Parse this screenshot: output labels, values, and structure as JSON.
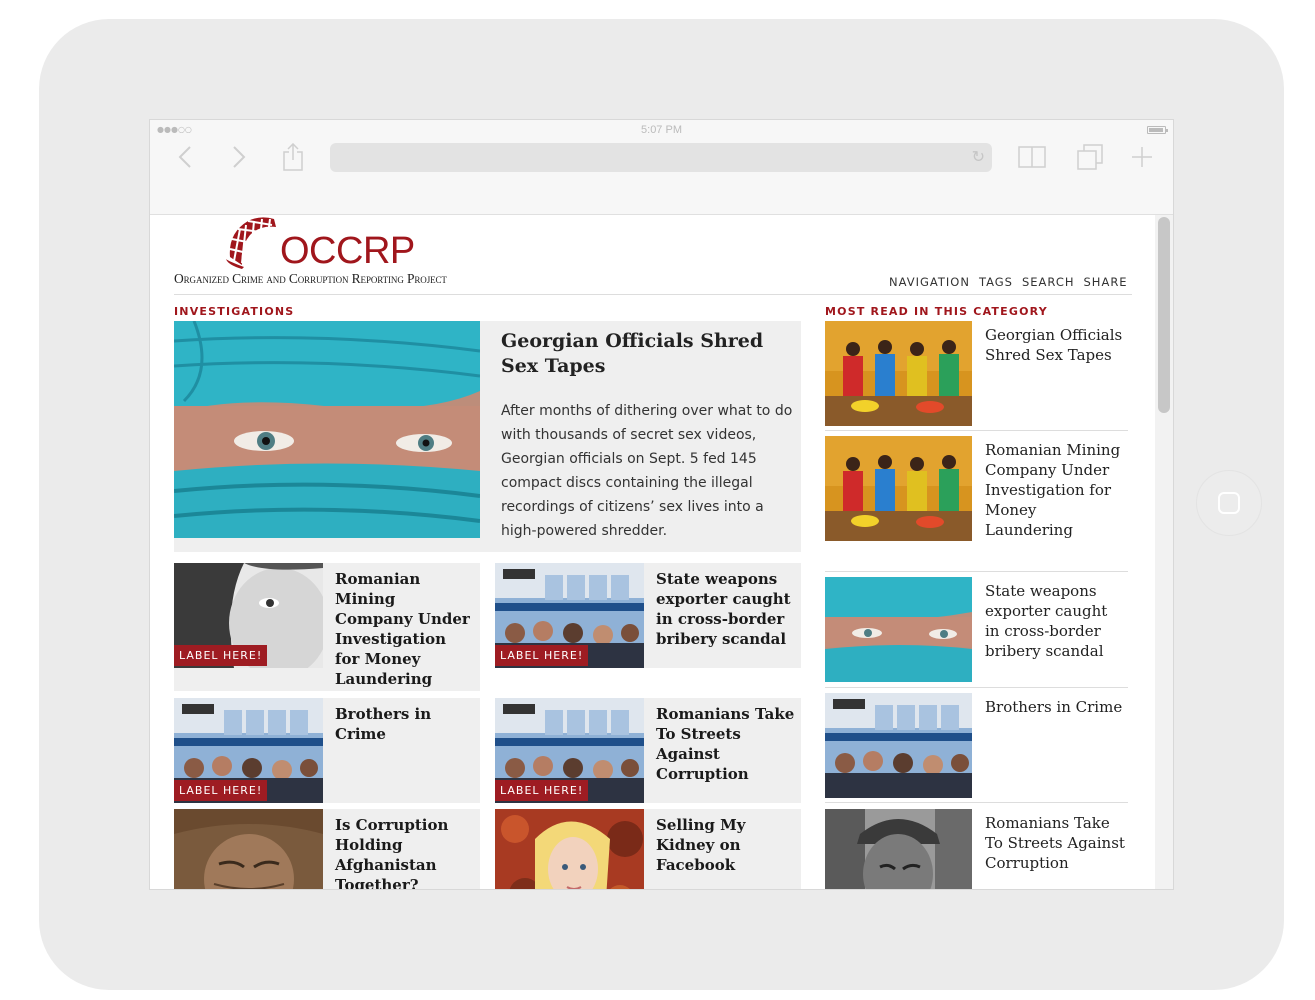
{
  "device": {
    "type": "tablet"
  },
  "statusbar": {
    "time": "5:07 PM",
    "signal": "●●●○○"
  },
  "browser": {
    "url": "",
    "reload_icon": "reload-icon"
  },
  "site": {
    "logo_name": "OCCRP",
    "logo_tagline": "Organized Crime and Corruption Reporting Project",
    "nav": [
      "NAVIGATION",
      "TAGS",
      "SEARCH",
      "SHARE"
    ]
  },
  "main": {
    "section_label": "INVESTIGATIONS",
    "featured": {
      "title": "Georgian Officials Shred Sex Tapes",
      "body": "After months of dithering over what to do with thousands of secret sex videos, Georgian officials on Sept. 5 fed 145 compact discs containing the illegal recordings of citizens’ sex lives into a high-powered shredder."
    },
    "cards": [
      {
        "title": "Romanian Mining Company Under Investigation for Money Laundering",
        "label": "LABEL HERE!"
      },
      {
        "title": "State weapons exporter caught in cross-border bribery scandal",
        "label": "LABEL HERE!"
      },
      {
        "title": "Brothers in Crime",
        "label": "LABEL HERE!"
      },
      {
        "title": "Romanians Take To Streets Against Corruption",
        "label": "LABEL HERE!"
      },
      {
        "title": "Is Corruption Holding Afghanistan Together?"
      },
      {
        "title": "Selling My Kidney on Facebook"
      }
    ]
  },
  "sidebar": {
    "section_label": "MOST READ IN THIS CATEGORY",
    "items": [
      {
        "title": "Georgian Officials Shred Sex Tapes"
      },
      {
        "title": "Romanian Mining Company Under Investigation for Money Laundering"
      },
      {
        "title": "State weapons exporter caught in cross-border bribery scandal"
      },
      {
        "title": "Brothers in Crime"
      },
      {
        "title": "Romanians Take To Streets Against Corruption"
      }
    ]
  },
  "colors": {
    "brand": "#a0161c",
    "card_bg": "#efefef",
    "label_bg": "#9e1c22"
  }
}
